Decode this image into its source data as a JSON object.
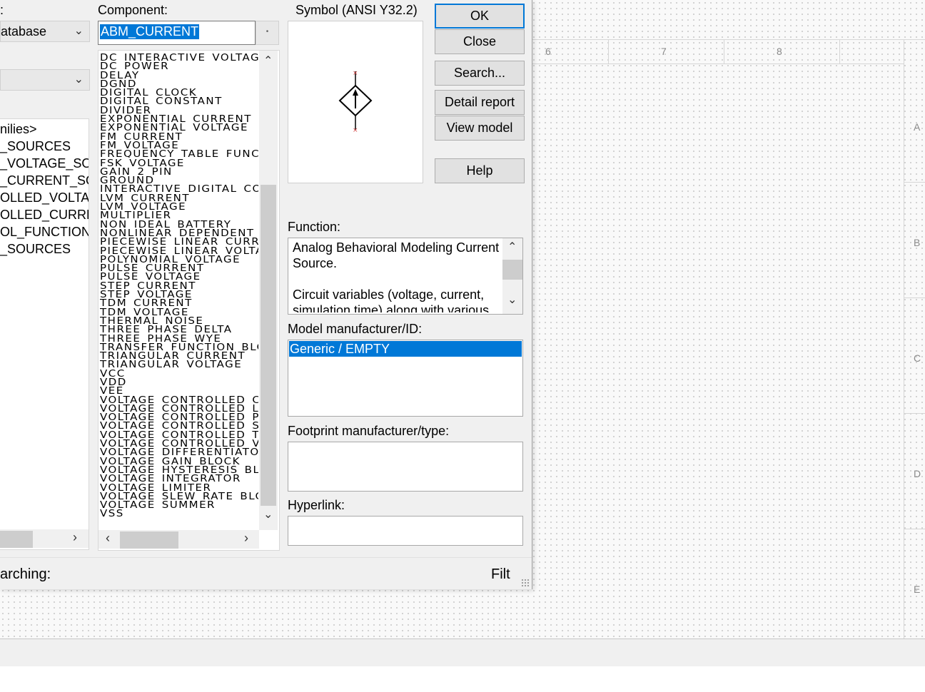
{
  "canvas": {
    "columns": [
      "6",
      "7",
      "8"
    ],
    "rows": [
      "A",
      "B",
      "C",
      "D",
      "E"
    ]
  },
  "dialog": {
    "left_pane": {
      "header_fragment": ":",
      "database_value": "atabase",
      "group_value": "",
      "families": [
        "nilies>",
        "_SOURCES",
        "_VOLTAGE_SOU",
        "_CURRENT_SOU",
        "OLLED_VOLTAG",
        "OLLED_CURREN",
        "OL_FUNCTION_",
        "_SOURCES"
      ]
    },
    "component": {
      "label": "Component:",
      "value": "ABM_CURRENT",
      "button_glyph": "•",
      "items": [
        "DC_INTERACTIVE_VOLTAGE",
        "DC_POWER",
        "DELAY",
        "DGND",
        "DIGITAL_CLOCK",
        "DIGITAL_CONSTANT",
        "DIVIDER",
        "EXPONENTIAL_CURRENT",
        "EXPONENTIAL_VOLTAGE",
        "FM_CURRENT",
        "FM_VOLTAGE",
        "FREQUENCY_TABLE_FUNCTION",
        "FSK_VOLTAGE",
        "GAIN_2_PIN",
        "GROUND",
        "INTERACTIVE_DIGITAL_CONSTANT",
        "LVM_CURRENT",
        "LVM_VOLTAGE",
        "MULTIPLIER",
        "NON_IDEAL_BATTERY",
        "NONLINEAR_DEPENDENT",
        "PIECEWISE_LINEAR_CURRENT",
        "PIECEWISE_LINEAR_VOLTAGE",
        "POLYNOMIAL_VOLTAGE",
        "PULSE_CURRENT",
        "PULSE_VOLTAGE",
        "STEP_CURRENT",
        "STEP_VOLTAGE",
        "TDM_CURRENT",
        "TDM_VOLTAGE",
        "THERMAL_NOISE",
        "THREE_PHASE_DELTA",
        "THREE_PHASE_WYE",
        "TRANSFER_FUNCTION_BLOCK",
        "TRIANGULAR_CURRENT",
        "TRIANGULAR_VOLTAGE",
        "VCC",
        "VDD",
        "VEE",
        "VOLTAGE_CONTROLLED_CURRENT",
        "VOLTAGE_CONTROLLED_LIMITER",
        "VOLTAGE_CONTROLLED_PIECEWISE",
        "VOLTAGE_CONTROLLED_SINE",
        "VOLTAGE_CONTROLLED_TRIANGLE",
        "VOLTAGE_CONTROLLED_VOLTAGE",
        "VOLTAGE_DIFFERENTIATOR",
        "VOLTAGE_GAIN_BLOCK",
        "VOLTAGE_HYSTERESIS_BLOCK",
        "VOLTAGE_INTEGRATOR",
        "VOLTAGE_LIMITER",
        "VOLTAGE_SLEW_RATE_BLOCK",
        "VOLTAGE_SUMMER",
        "VSS"
      ]
    },
    "symbol": {
      "label": "Symbol (ANSI Y32.2)"
    },
    "buttons": {
      "ok": "OK",
      "close": "Close",
      "search": "Search...",
      "detail_report": "Detail report",
      "view_model": "View model",
      "help": "Help"
    },
    "function": {
      "label": "Function:",
      "line1": "Analog Behavioral Modeling Current Source.",
      "line2": "Circuit variables (voltage, current, simulation time) along with various"
    },
    "model": {
      "label": "Model manufacturer/ID:",
      "selected": "Generic / EMPTY"
    },
    "footprint": {
      "label": "Footprint manufacturer/type:",
      "value": ""
    },
    "hyperlink": {
      "label": "Hyperlink:",
      "value": ""
    },
    "status": {
      "searching": "arching:",
      "filter": "Filt"
    }
  },
  "colors": {
    "selection": "#0078d7",
    "dialog_bg": "#f0f0f0"
  }
}
